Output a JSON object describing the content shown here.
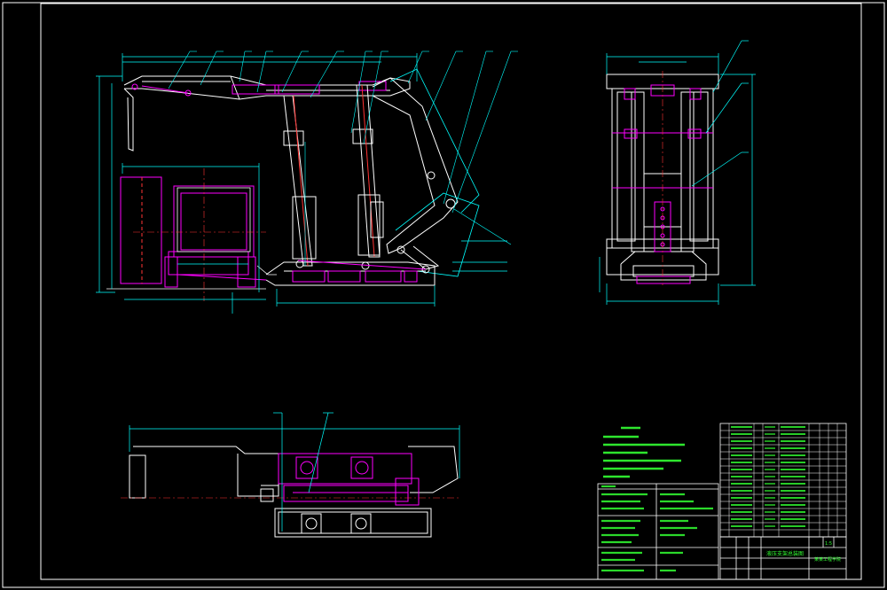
{
  "drawing": {
    "colors": {
      "background": "#000000",
      "frame": "#ffffff",
      "outline": "#ffffff",
      "dimension": "#00ffff",
      "hidden_part": "#ff00ff",
      "center_line": "#ff3333",
      "leader": "#00ffff",
      "note_text": "#33ff33",
      "table_line": "#ffffff",
      "table_text": "#33ff33"
    },
    "title_block": {
      "drawing_title": "液压支架总装图",
      "school": "某某工程学院",
      "scale": "1:5"
    }
  }
}
